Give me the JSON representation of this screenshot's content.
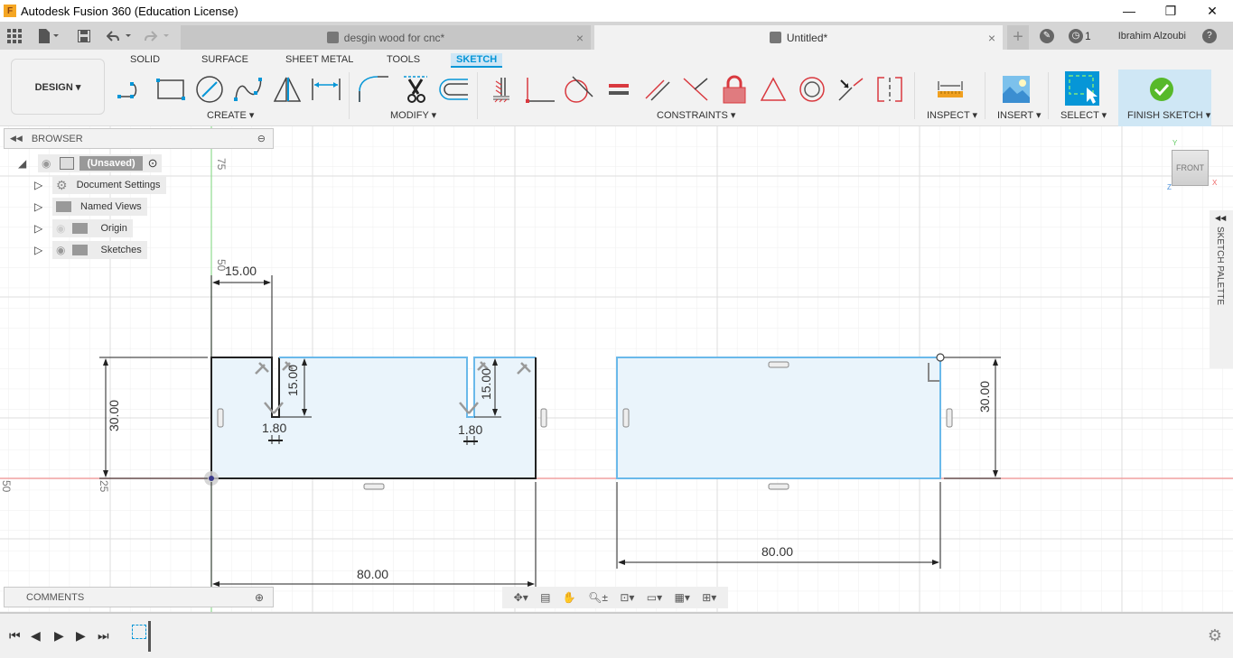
{
  "window": {
    "title": "Autodesk Fusion 360 (Education License)",
    "app_icon": "F",
    "controls": {
      "minimize": "—",
      "maximize": "❐",
      "close": "✕"
    }
  },
  "tabs": [
    {
      "label": "desgin wood for cnc*",
      "active": false,
      "close": "×"
    },
    {
      "label": "Untitled*",
      "active": true,
      "close": "×"
    }
  ],
  "top_right": {
    "new_tab": "+",
    "job_count": "1",
    "user": "Ibrahim Alzoubi",
    "help": "?"
  },
  "ribbon": {
    "workspace": "DESIGN ▾",
    "tabs": [
      {
        "label": "SOLID",
        "active": false
      },
      {
        "label": "SURFACE",
        "active": false
      },
      {
        "label": "SHEET METAL",
        "active": false
      },
      {
        "label": "TOOLS",
        "active": false
      },
      {
        "label": "SKETCH",
        "active": true
      }
    ],
    "groups": {
      "create": "CREATE ▾",
      "modify": "MODIFY ▾",
      "constraints": "CONSTRAINTS ▾",
      "inspect": "INSPECT ▾",
      "insert": "INSERT ▾",
      "select": "SELECT ▾",
      "finish": "FINISH SKETCH ▾"
    },
    "create_tools": [
      "line-icon",
      "rectangle-icon",
      "circle-icon",
      "spline-icon",
      "mirror-icon",
      "dimension-icon"
    ],
    "modify_tools": [
      "fillet-icon",
      "trim-icon",
      "offset-icon"
    ],
    "constraint_tools": [
      "fix-icon",
      "coincident-icon",
      "tangent-icon",
      "equal-icon",
      "parallel-icon",
      "perpendicular-icon",
      "lock-icon",
      "midpoint-icon",
      "concentric-icon",
      "collinear-icon",
      "symmetry-icon"
    ]
  },
  "browser": {
    "title": "BROWSER",
    "root": "(Unsaved)",
    "items": [
      {
        "label": "Document Settings",
        "icon": "gear-icon"
      },
      {
        "label": "Named Views",
        "icon": "folder-icon"
      },
      {
        "label": "Origin",
        "icon": "folder-icon"
      },
      {
        "label": "Sketches",
        "icon": "folder-icon"
      }
    ]
  },
  "comments": {
    "title": "COMMENTS"
  },
  "viewcube": {
    "face": "FRONT",
    "x": "X",
    "y": "Y",
    "z": "Z"
  },
  "sketch_palette": {
    "title": "SKETCH PALETTE"
  },
  "grid_labels": {
    "v75": "75",
    "v50": "50",
    "h25": "25",
    "h50": "50",
    "c25": "25"
  },
  "dimensions": {
    "left_width_top": "15.00",
    "left_height": "30.00",
    "slot1_depth": "15.00",
    "slot1_width": "1.80",
    "slot2_depth": "15.00",
    "slot2_width": "1.80",
    "left_width": "80.00",
    "right_width": "80.00",
    "right_height": "30.00"
  }
}
